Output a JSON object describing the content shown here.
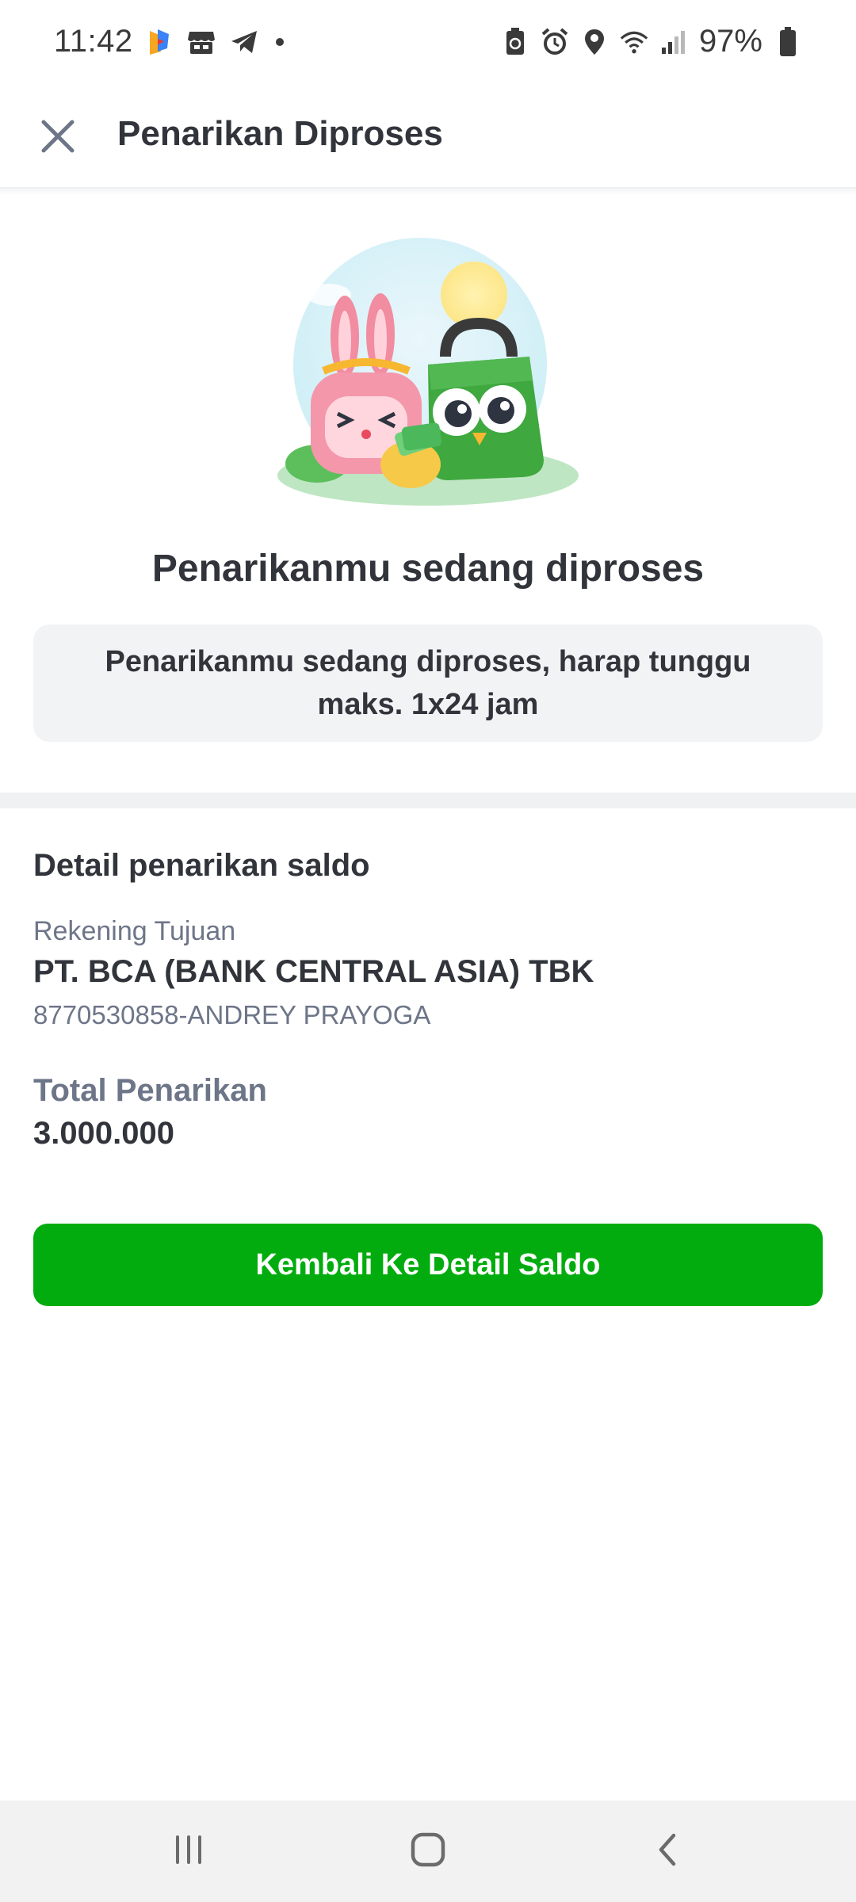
{
  "status_bar": {
    "time": "11:42",
    "battery_percent": "97%"
  },
  "header": {
    "title": "Penarikan Diproses"
  },
  "content": {
    "main_title": "Penarikanmu sedang diproses",
    "info_message": "Penarikanmu sedang diproses, harap tunggu maks. 1x24 jam"
  },
  "details": {
    "heading": "Detail penarikan saldo",
    "account_label": "Rekening Tujuan",
    "bank_name": "PT. BCA (BANK CENTRAL ASIA) TBK",
    "account_number": "8770530858-ANDREY PRAYOGA",
    "total_label": "Total Penarikan",
    "total_value": "3.000.000"
  },
  "actions": {
    "back_button_label": "Kembali Ke Detail Saldo"
  },
  "colors": {
    "primary_green": "#03ac0e",
    "text_dark": "#31353b",
    "text_muted": "#6d7588",
    "info_bg": "#f2f3f5"
  },
  "icons": {
    "close": "close-icon",
    "nav_recents": "recents-icon",
    "nav_home": "home-icon",
    "nav_back": "back-icon"
  }
}
